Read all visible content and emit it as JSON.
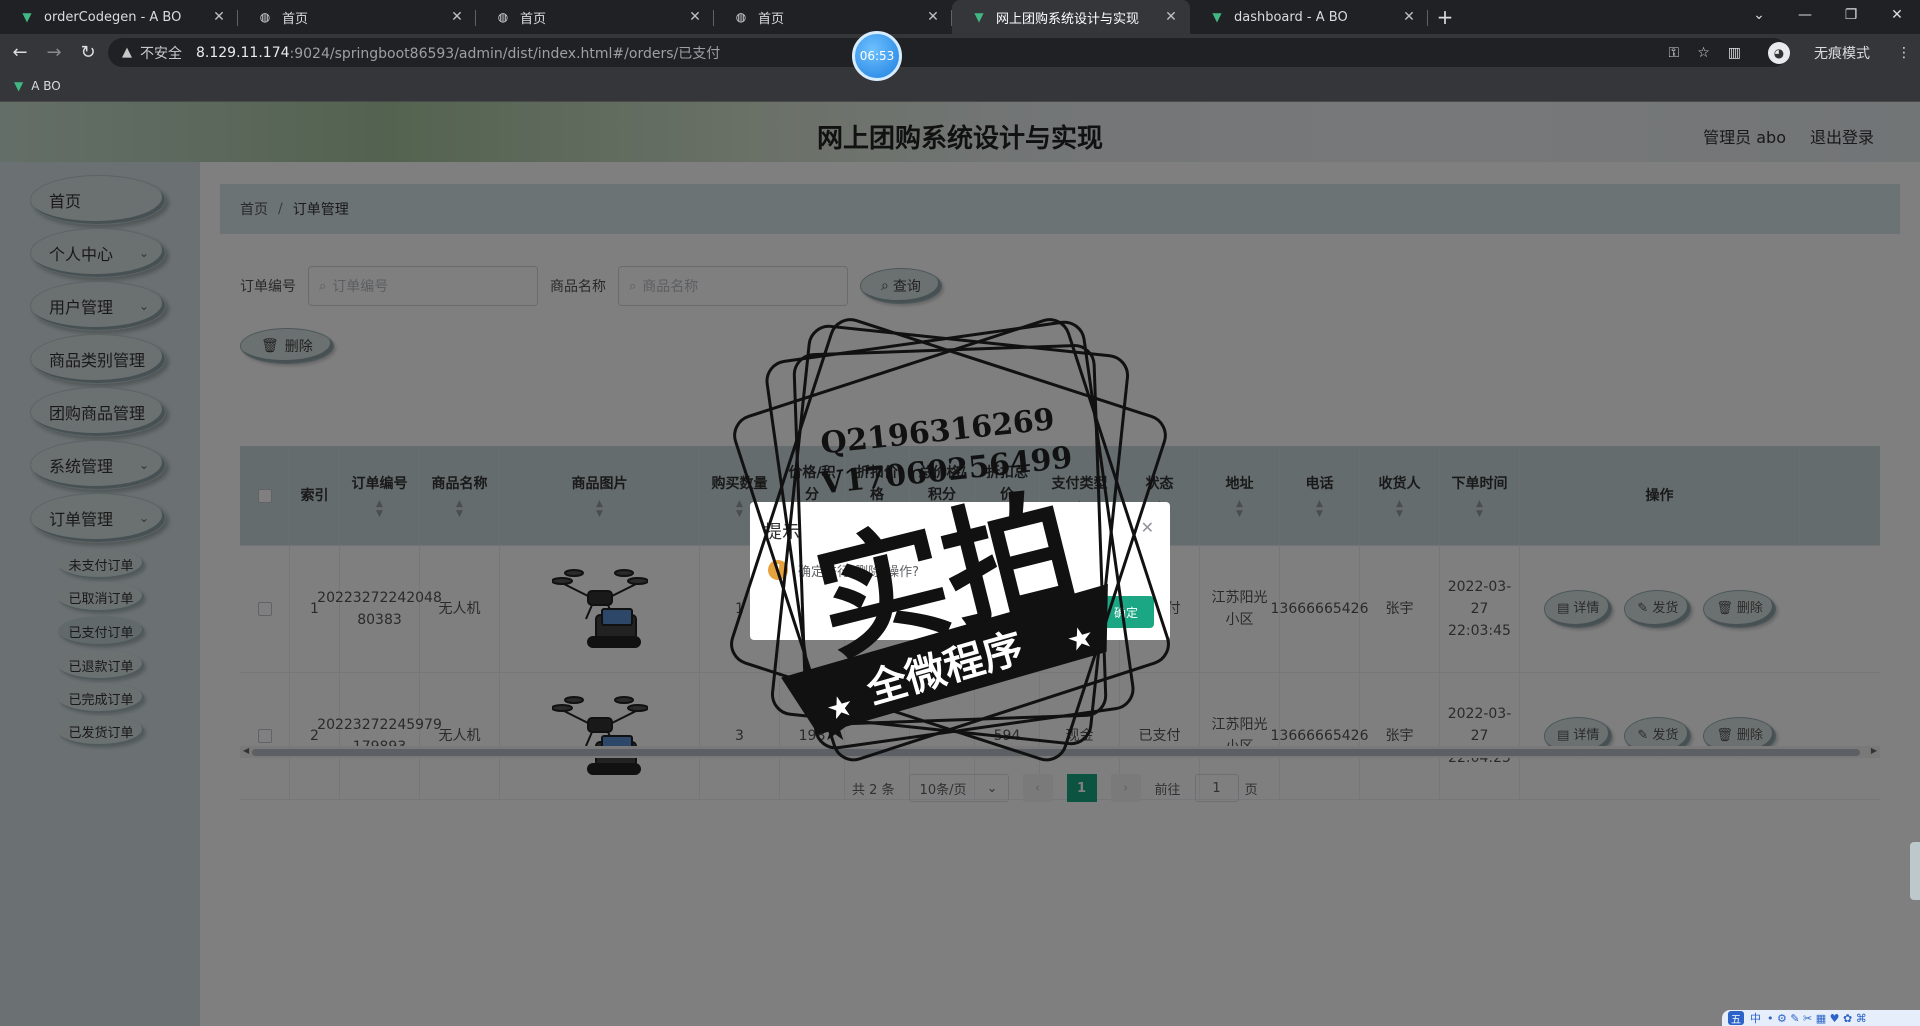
{
  "browser": {
    "tabs": [
      {
        "title": "orderCodegen - A BO",
        "icon": "vue-icon"
      },
      {
        "title": "首页",
        "icon": "globe-icon"
      },
      {
        "title": "首页",
        "icon": "globe-icon"
      },
      {
        "title": "首页",
        "icon": "globe-icon"
      },
      {
        "title": "网上团购系统设计与实现",
        "icon": "vue-icon",
        "active": true
      },
      {
        "title": "dashboard - A BO",
        "icon": "vue-icon"
      }
    ],
    "insecure_label": "不安全",
    "url_host": "8.129.11.174",
    "url_rest": ":9024/springboot86593/admin/dist/index.html#/orders/已支付",
    "incognito_label": "无痕模式",
    "bookmark": "A BO",
    "timer": "06:53"
  },
  "app": {
    "title": "网上团购系统设计与实现",
    "user": "管理员 abo",
    "logout": "退出登录"
  },
  "sidebar": {
    "items": [
      {
        "label": "首页",
        "has_children": false
      },
      {
        "label": "个人中心",
        "has_children": true
      },
      {
        "label": "用户管理",
        "has_children": true
      },
      {
        "label": "商品类别管理",
        "has_children": false
      },
      {
        "label": "团购商品管理",
        "has_children": false
      },
      {
        "label": "系统管理",
        "has_children": true
      },
      {
        "label": "订单管理",
        "has_children": true
      }
    ],
    "sub_items": [
      {
        "label": "未支付订单"
      },
      {
        "label": "已取消订单"
      },
      {
        "label": "已支付订单",
        "active": true
      },
      {
        "label": "已退款订单"
      },
      {
        "label": "已完成订单"
      },
      {
        "label": "已发货订单"
      }
    ]
  },
  "breadcrumb": {
    "home": "首页",
    "sep": "/",
    "current": "订单管理"
  },
  "filters": {
    "order_no_label": "订单编号",
    "order_no_placeholder": "订单编号",
    "product_label": "商品名称",
    "product_placeholder": "商品名称",
    "query_button": "查询",
    "delete_button": "删除"
  },
  "table": {
    "headers": [
      "索引",
      "订单编号",
      "商品名称",
      "商品图片",
      "购买数量",
      "价格/积分",
      "折扣价格",
      "总价格/积分",
      "折扣总价",
      "支付类型",
      "状态",
      "地址",
      "电话",
      "收货人",
      "下单时间",
      "操作"
    ],
    "rows": [
      {
        "index": "1",
        "order_no": "20223272242048 80383",
        "product": "无人机",
        "qty": "1",
        "price": "",
        "discount": "",
        "total": "",
        "discount_total": "",
        "pay_type": "",
        "status": "已支付",
        "address": "江苏阳光小区",
        "phone": "13666665426",
        "receiver": "张宇",
        "time": "2022-03-27 22:03:45"
      },
      {
        "index": "2",
        "order_no": "20223272245979 179893",
        "product": "无人机",
        "qty": "3",
        "price": "198",
        "discount": "",
        "total": "",
        "discount_total": "594",
        "pay_type": "现金",
        "status": "已支付",
        "address": "江苏阳光小区",
        "phone": "13666665426",
        "receiver": "张宇",
        "time": "2022-03-27 22:04:25"
      }
    ],
    "actions": {
      "detail": "详情",
      "ship": "发货",
      "delete": "删除"
    }
  },
  "pagination": {
    "total": "共 2 条",
    "page_size": "10条/页",
    "current": "1",
    "goto_label": "前往",
    "goto_value": "1",
    "page_unit": "页"
  },
  "dialog": {
    "title": "提示",
    "message": "确定进行[删除]操作?",
    "cancel": "取消",
    "ok": "确定"
  },
  "watermark": {
    "qq": "Q2196316269",
    "wechat": "V17060256499",
    "main": "实拍",
    "banner": "全微程序"
  },
  "ime": {
    "label": "中"
  }
}
